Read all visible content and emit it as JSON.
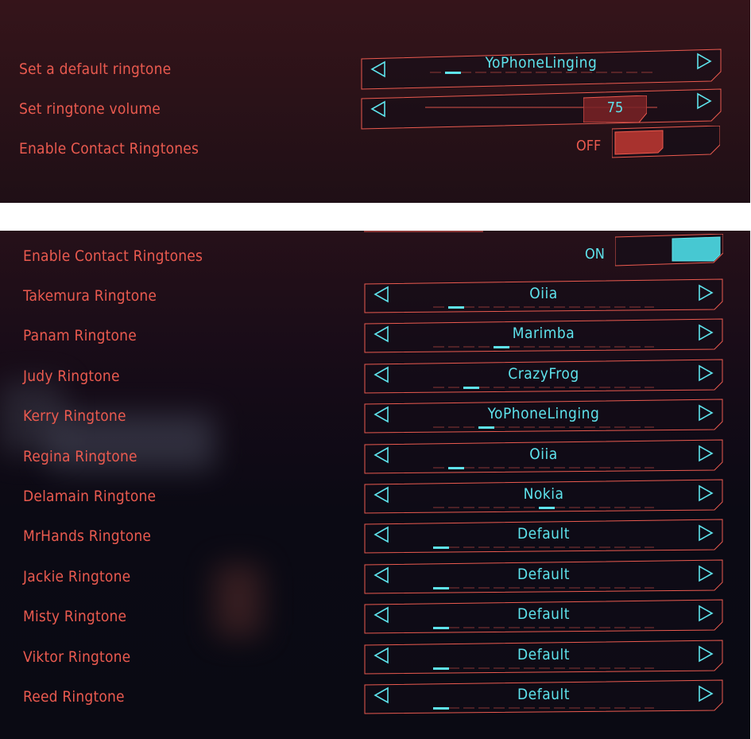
{
  "top_panel": {
    "default_ringtone": {
      "label": "Set a default ringtone",
      "value": "YoPhoneLinging",
      "selected_index": 1,
      "option_count": 12
    },
    "volume": {
      "label": "Set ringtone volume",
      "value": "75",
      "level_percent": 75
    },
    "contact_ringtones": {
      "label": "Enable Contact Ringtones",
      "state": "OFF"
    }
  },
  "bottom_panel": {
    "contact_ringtones": {
      "label": "Enable Contact Ringtones",
      "state": "ON"
    },
    "ringtones": [
      {
        "label": "Takemura Ringtone",
        "value": "Oiia",
        "selected_index": 1
      },
      {
        "label": "Panam Ringtone",
        "value": "Marimba",
        "selected_index": 4
      },
      {
        "label": "Judy Ringtone",
        "value": "CrazyFrog",
        "selected_index": 2
      },
      {
        "label": "Kerry Ringtone",
        "value": "YoPhoneLinging",
        "selected_index": 3
      },
      {
        "label": "Regina Ringtone",
        "value": "Oiia",
        "selected_index": 1
      },
      {
        "label": "Delamain Ringtone",
        "value": "Nokia",
        "selected_index": 7
      },
      {
        "label": "MrHands Ringtone",
        "value": "Default",
        "selected_index": 0
      },
      {
        "label": "Jackie Ringtone",
        "value": "Default",
        "selected_index": 0
      },
      {
        "label": "Misty Ringtone",
        "value": "Default",
        "selected_index": 0
      },
      {
        "label": "Viktor Ringtone",
        "value": "Default",
        "selected_index": 0
      },
      {
        "label": "Reed Ringtone",
        "value": "Default",
        "selected_index": 0
      }
    ]
  },
  "icons": {
    "previous": "triangle-left-icon",
    "next": "triangle-right-icon"
  },
  "colors": {
    "accent_red": "#ea5a4f",
    "accent_cyan": "#5ee3ec",
    "toggle_off": "#a8322e",
    "toggle_on": "#47c8d2"
  }
}
